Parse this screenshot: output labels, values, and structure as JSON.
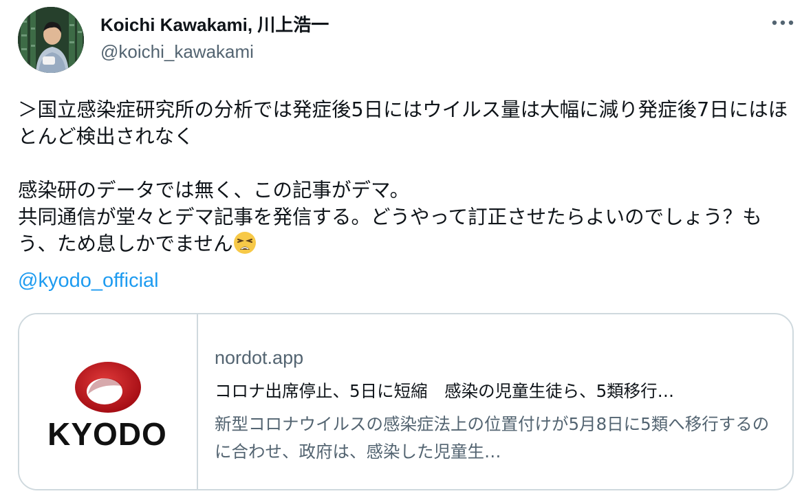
{
  "author": {
    "display_name": "Koichi Kawakami, 川上浩一",
    "handle": "@koichi_kawakami",
    "avatar_icon": "avatar-photo"
  },
  "more_icon": "more-options-icon",
  "tweet": {
    "paragraph1": "＞国立感染症研究所の分析では発症後5日にはウイルス量は大幅に減り発症後7日にはほとんど検出されなく",
    "line2": "感染研のデータでは無く、この記事がデマ。",
    "line3": "共同通信が堂々とデマ記事を発信する。どうやって訂正させたらよいのでしょう？もう、ため息しかでません",
    "emoji": "weary-face-emoji",
    "mention": "@kyodo_official"
  },
  "card": {
    "logo_text": "KYODO",
    "domain": "nordot.app",
    "title": "コロナ出席停止、5日に短縮　感染の児童生徒ら、5類移行…",
    "description": "新型コロナウイルスの感染症法上の位置付けが5月8日に5類へ移行するのに合わせ、政府は、感染した児童生…"
  },
  "colors": {
    "text": "#0f1419",
    "secondary": "#536471",
    "link": "#1d9bf0",
    "border": "#cfd9de",
    "kyodo_red": "#c8141e"
  }
}
